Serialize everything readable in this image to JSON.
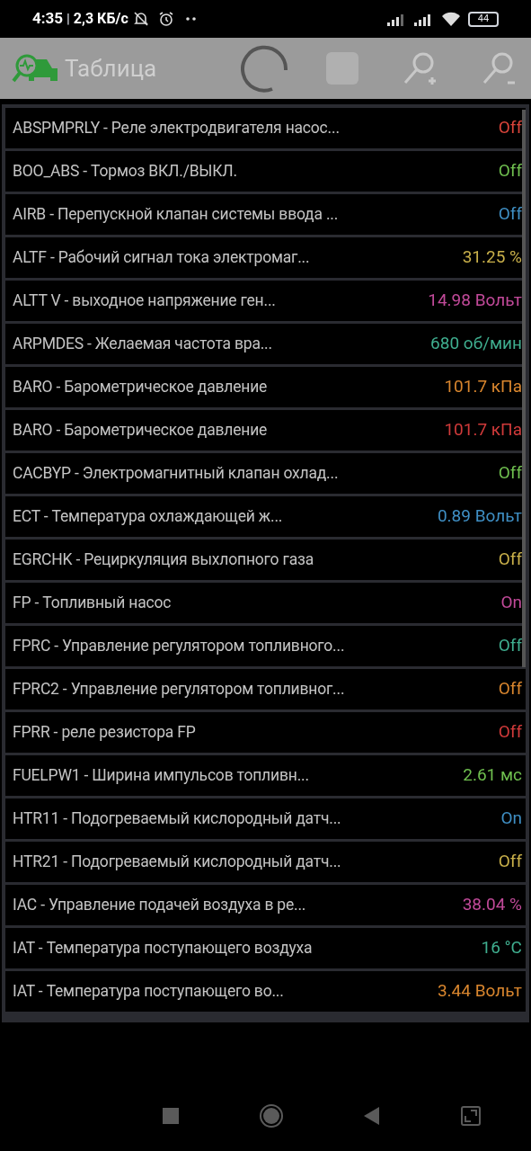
{
  "status_bar": {
    "time": "4:35",
    "separator": "|",
    "speed": "2,3 КБ/с",
    "battery": "44"
  },
  "toolbar": {
    "title": "Таблица"
  },
  "rows": [
    {
      "name": "ABSPMPRLY - Реле электродвигателя насос...",
      "value": "Off",
      "color": "#d9443a"
    },
    {
      "name": "BOO_ABS - Тормоз ВКЛ./ВЫКЛ.",
      "value": "Off",
      "color": "#6fbf4f"
    },
    {
      "name": "AIRB - Перепускной клапан системы ввода ...",
      "value": "Off",
      "color": "#3f8fc4"
    },
    {
      "name": "ALTF - Рабочий сигнал тока электромаг...",
      "value": "31.25 %",
      "color": "#c9b04a"
    },
    {
      "name": "ALTT V - выходное напряжение ген...",
      "value": "14.98 Вольт",
      "color": "#c24a9a"
    },
    {
      "name": "ARPMDES - Желаемая частота вра...",
      "value": "680 об/мин",
      "color": "#3fae8f"
    },
    {
      "name": "BARO - Барометрическое давление",
      "value": "101.7 кПа",
      "color": "#d9862e"
    },
    {
      "name": "BARO - Барометрическое давление",
      "value": "101.7 кПа",
      "color": "#d03a3a"
    },
    {
      "name": "CACBYP - Электромагнитный клапан охлад...",
      "value": "Off",
      "color": "#6fbf4f"
    },
    {
      "name": "ECT - Температура охлаждающей ж...",
      "value": "0.89 Вольт",
      "color": "#3f8fc4"
    },
    {
      "name": "EGRCHK - Рециркуляция выхлопного газа",
      "value": "Off",
      "color": "#c9b04a"
    },
    {
      "name": "FP - Топливный насос",
      "value": "On",
      "color": "#c24a9a"
    },
    {
      "name": "FPRC - Управление регулятором топливного...",
      "value": "Off",
      "color": "#3fae8f"
    },
    {
      "name": "FPRC2 - Управление регулятором топливног...",
      "value": "Off",
      "color": "#d9862e"
    },
    {
      "name": "FPRR - реле резистора FP",
      "value": "Off",
      "color": "#d03a3a"
    },
    {
      "name": "FUELPW1 - Ширина импульсов топливн...",
      "value": "2.61 мс",
      "color": "#6fbf4f"
    },
    {
      "name": "HTR11 - Подогреваемый кислородный датч...",
      "value": "On",
      "color": "#3f8fc4"
    },
    {
      "name": "HTR21 - Подогреваемый кислородный датч...",
      "value": "Off",
      "color": "#c9b04a"
    },
    {
      "name": "IAC - Управление подачей воздуха в ре...",
      "value": "38.04 %",
      "color": "#c24a9a"
    },
    {
      "name": "IAT - Температура поступающего воздуха",
      "value": "16 °C",
      "color": "#3fae8f"
    },
    {
      "name": "IAT - Температура поступающего во...",
      "value": "3.44 Вольт",
      "color": "#d9862e"
    }
  ]
}
